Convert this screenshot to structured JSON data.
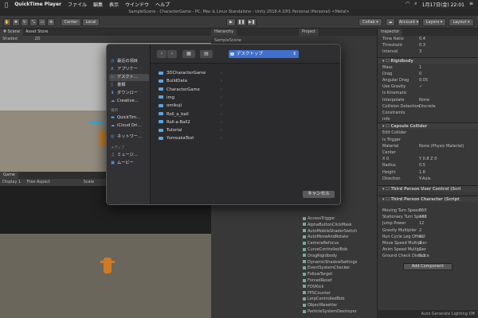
{
  "menubar": {
    "app": "QuickTime Player",
    "items": [
      "ファイル",
      "編集",
      "表示",
      "ウインドウ",
      "ヘルプ"
    ],
    "datetime": "1月17日(金) 22:01"
  },
  "window_title": "SampleScene - CharacterGame - PC, Mac & Linux Standalone - Unity 2018.4.10f1 Personal (Personal) <Metal>",
  "toolbar": {
    "pivot": "Center",
    "local": "Local",
    "collab": "Collab ▾",
    "account": "Account ▾",
    "layers": "Layers ▾",
    "layout": "Layout ▾"
  },
  "scene": {
    "tabs": [
      "# Scene",
      "Asset Store"
    ],
    "shading": "Shaded",
    "mode": "2D"
  },
  "game": {
    "tab": "Game",
    "display": "Display 1",
    "aspect": "Free Aspect",
    "scale": "Scale"
  },
  "hierarchy": {
    "tab": "Hierarchy",
    "project_tab": "Project",
    "items": [
      "SampleScene"
    ]
  },
  "project_scripts": [
    "AccessTrigger",
    "AlphaButtonClickMask",
    "AutoMobileShaderSwitch",
    "AutoMoveAndRotate",
    "CameraRefocus",
    "CurveControlledBob",
    "DragRigidbody",
    "DynamicShadowSettings",
    "EventSystemChecker",
    "FollowTarget",
    "ForcedReset",
    "FOVKick",
    "FPSCounter",
    "LerpControlledBob",
    "ObjectResetter",
    "ParticleSystemDestroyer"
  ],
  "inspector": {
    "tab": "Inspector",
    "top_rows": [
      {
        "label": "Time Ratio",
        "value": "0.4"
      },
      {
        "label": "Threshold",
        "value": "0.3"
      },
      {
        "label": "Interval",
        "value": "3"
      }
    ],
    "rigidbody": {
      "header": "Rigidbody",
      "rows": [
        {
          "label": "Mass",
          "value": "1"
        },
        {
          "label": "Drag",
          "value": "0"
        },
        {
          "label": "Angular Drag",
          "value": "0.05"
        },
        {
          "label": "Use Gravity",
          "value": "✓"
        },
        {
          "label": "Is Kinematic",
          "value": ""
        },
        {
          "label": "Interpolate",
          "value": "None"
        },
        {
          "label": "Collision Detection",
          "value": "Discrete"
        },
        {
          "label": "Constraints",
          "value": ""
        },
        {
          "label": "Info",
          "value": ""
        }
      ]
    },
    "capsule": {
      "header": "Capsule Collider",
      "rows": [
        {
          "label": "Edit Collider",
          "value": ""
        },
        {
          "label": "Is Trigger",
          "value": ""
        },
        {
          "label": "Material",
          "value": "None (Physic Material)"
        },
        {
          "label": "Center",
          "value": ""
        },
        {
          "label": "X 0",
          "value": "Y 0.8   Z 0"
        },
        {
          "label": "Radius",
          "value": "0.5"
        },
        {
          "label": "Height",
          "value": "1.6"
        },
        {
          "label": "Direction",
          "value": "Y-Axis"
        }
      ]
    },
    "third_control": "Third Person User Control (Scri",
    "third_char": {
      "header": "Third Person Character (Script",
      "rows": [
        {
          "label": "Moving Turn Speed",
          "value": "360"
        },
        {
          "label": "Stationary Turn Speed",
          "value": "180"
        },
        {
          "label": "Jump Power",
          "value": "12"
        },
        {
          "label": "Gravity Multiplier",
          "value": "2"
        },
        {
          "label": "Run Cycle Leg Offset",
          "value": "0.2"
        },
        {
          "label": "Move Speed Multiplier",
          "value": "1"
        },
        {
          "label": "Anim Speed Multiplier",
          "value": "1"
        },
        {
          "label": "Ground Check Distance",
          "value": "0.2"
        }
      ]
    },
    "add_component": "Add Component"
  },
  "status_bar": "Auto Generate Lighting Off",
  "dialog": {
    "location": "デスクトップ",
    "sidebar": {
      "items": [
        {
          "label": "最近の項目",
          "icon": "clock-icon"
        },
        {
          "label": "アプリケー",
          "icon": "apps-icon"
        },
        {
          "label": "デスクト…",
          "icon": "desktop-icon"
        },
        {
          "label": "書類",
          "icon": "document-icon"
        },
        {
          "label": "ダウンロー",
          "icon": "download-icon"
        },
        {
          "label": "Creative…",
          "icon": "cloud-icon"
        }
      ],
      "locations_head": "場所",
      "locations": [
        {
          "label": "QuickTim…",
          "icon": "disk-icon"
        },
        {
          "label": "iCloud Dri…",
          "icon": "cloud-icon"
        }
      ],
      "network": {
        "label": "ネットワー…",
        "icon": "network-icon"
      },
      "media_head": "メディア",
      "media": [
        {
          "label": "ミュージ…",
          "icon": "music-icon"
        },
        {
          "label": "ムービー",
          "icon": "movie-icon"
        }
      ]
    },
    "folders": [
      "3DCharacterGame",
      "BuildData",
      "CharacterGame",
      "img",
      "omikuji",
      "Roll_a_ball",
      "Roll-a-Ball2",
      "Tutorial",
      "YumeakaTest"
    ],
    "cancel": "キャンセル"
  }
}
